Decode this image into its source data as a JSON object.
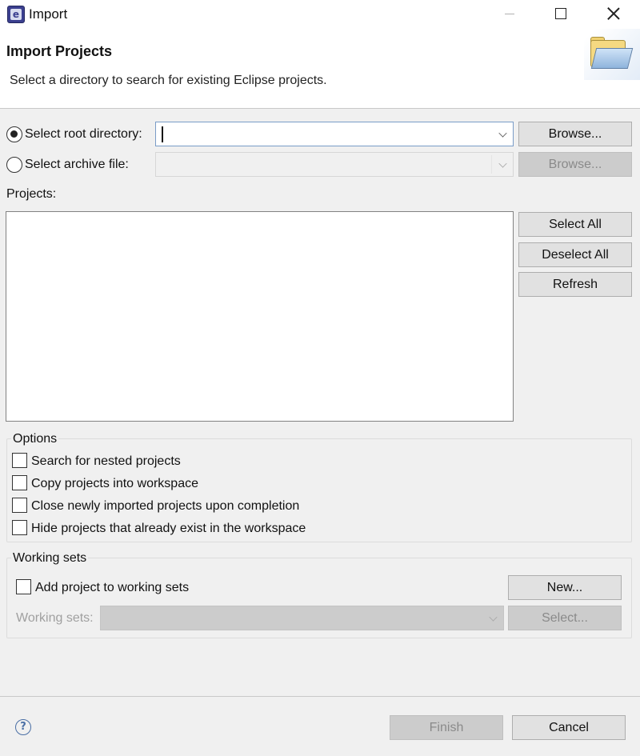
{
  "window": {
    "title": "Import",
    "app_icon": "eclipse-icon",
    "app_icon_glyph": "e"
  },
  "banner": {
    "title": "Import Projects",
    "description": "Select a directory to search for existing Eclipse projects.",
    "graphic": "open-folder-icon"
  },
  "source": {
    "root_label": "Select root directory:",
    "root_selected": true,
    "root_value": "",
    "archive_label": "Select archive file:",
    "archive_selected": false,
    "archive_value": "",
    "browse_label": "Browse..."
  },
  "projects": {
    "label": "Projects:",
    "items": [],
    "select_all": "Select All",
    "deselect_all": "Deselect All",
    "refresh": "Refresh"
  },
  "options": {
    "title": "Options",
    "items": [
      {
        "label": "Search for nested projects",
        "checked": false
      },
      {
        "label": "Copy projects into workspace",
        "checked": false
      },
      {
        "label": "Close newly imported projects upon completion",
        "checked": false
      },
      {
        "label": "Hide projects that already exist in the workspace",
        "checked": false
      }
    ]
  },
  "working_sets": {
    "title": "Working sets",
    "add_label": "Add project to working sets",
    "add_checked": false,
    "new_label": "New...",
    "sets_label": "Working sets:",
    "sets_value": "",
    "select_label": "Select..."
  },
  "footer": {
    "help_glyph": "?",
    "finish": "Finish",
    "cancel": "Cancel"
  }
}
